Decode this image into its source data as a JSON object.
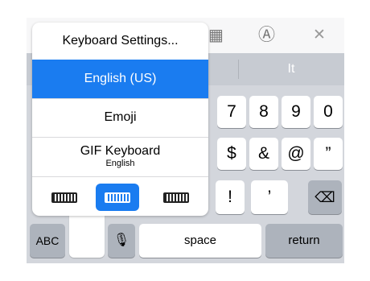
{
  "toolbar": {
    "icons": [
      "table-icon",
      "handwriting-icon",
      "close-icon"
    ],
    "table_glyph": "▦",
    "handwriting_glyph": "Ⓐ",
    "close_glyph": "✕"
  },
  "suggestions": [
    "It"
  ],
  "menu": {
    "keyboard_settings": "Keyboard Settings...",
    "english_us": "English (US)",
    "emoji": "Emoji",
    "gif_keyboard": "GIF Keyboard",
    "gif_keyboard_subtitle": "English",
    "selected": "English (US)",
    "layout_switch_icons": [
      "keyboard-left-icon",
      "keyboard-full-icon",
      "keyboard-right-icon"
    ]
  },
  "keys": {
    "row1": [
      "7",
      "8",
      "9",
      "0"
    ],
    "row2": [
      "$",
      "&",
      "@",
      "”"
    ],
    "row3": [
      "!",
      "’"
    ],
    "delete_glyph": "⌫",
    "abc": "ABC",
    "mic_glyph": "🎙",
    "space": "space",
    "return": "return"
  },
  "colors": {
    "accent": "#1a7cf0",
    "keyboard_bg": "#d3d6dc",
    "dark_key": "#adb3bc"
  }
}
